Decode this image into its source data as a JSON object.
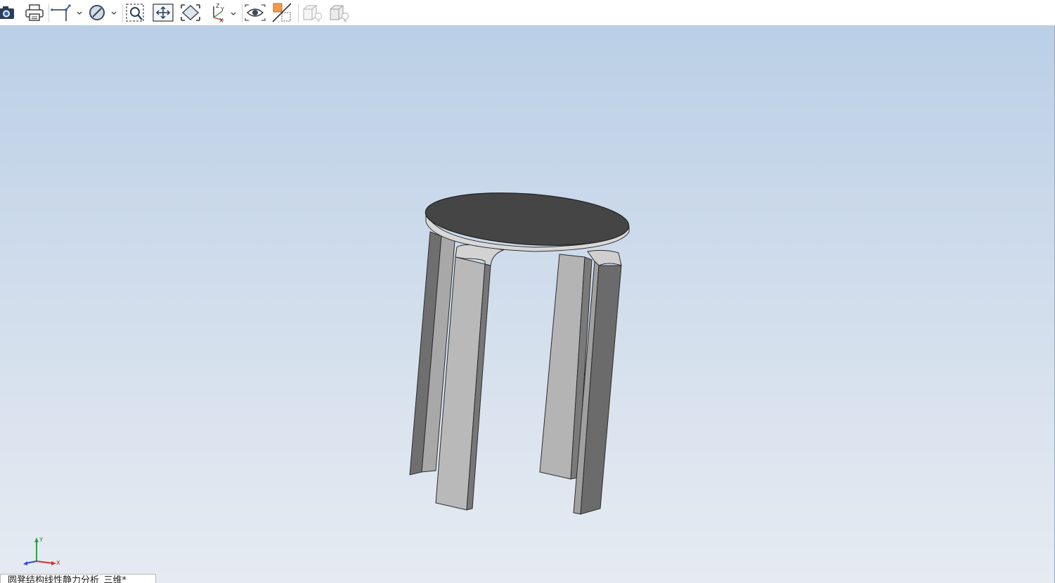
{
  "toolbar": {
    "items": [
      {
        "name": "camera-icon"
      },
      {
        "name": "print-icon"
      },
      {
        "name": "sketch-line-icon",
        "dropdown": true
      },
      {
        "name": "section-view-icon",
        "dropdown": true
      },
      {
        "name": "zoom-to-area-icon"
      },
      {
        "name": "pan-icon"
      },
      {
        "name": "zoom-fit-icon"
      },
      {
        "name": "view-orientation-icon",
        "dropdown": true
      },
      {
        "name": "hide-show-icon"
      },
      {
        "name": "edit-appearance-icon"
      },
      {
        "name": "apply-scene-icon",
        "disabled": true
      },
      {
        "name": "view-settings-icon",
        "disabled": true
      }
    ]
  },
  "triad": {
    "y_label": "Y",
    "x_label": "X"
  },
  "document_tab": {
    "title": "圆凳结构线性静力分析_三维*"
  },
  "colors": {
    "viewport_top": "#bacfe6",
    "viewport_bottom": "#e6ebf2",
    "seat_top": "#454545",
    "leg_face": "#b9b9b9",
    "leg_side": "#6e6e6e"
  }
}
